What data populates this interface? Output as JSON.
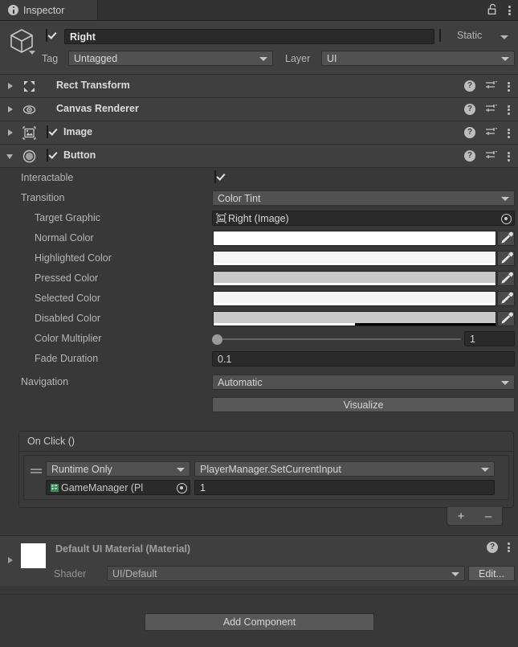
{
  "window": {
    "tab_label": "Inspector",
    "tab_icon": "info-icon",
    "lock_icon": "lock-open-icon",
    "menu_icon": "kebab-menu-icon"
  },
  "gameobject": {
    "icon": "cube-icon",
    "enabled": true,
    "name": "Right",
    "static_enabled": false,
    "static_label": "Static",
    "tag_label": "Tag",
    "tag_value": "Untagged",
    "layer_label": "Layer",
    "layer_value": "UI"
  },
  "components": [
    {
      "name": "Rect Transform",
      "icon": "rect-transform-icon",
      "expanded": false,
      "has_toggle": false,
      "enabled": false
    },
    {
      "name": "Canvas Renderer",
      "icon": "eye-icon",
      "expanded": false,
      "has_toggle": false,
      "enabled": false
    },
    {
      "name": "Image",
      "icon": "image-icon",
      "expanded": false,
      "has_toggle": true,
      "enabled": true
    },
    {
      "name": "Button",
      "icon": "button-icon",
      "expanded": true,
      "has_toggle": true,
      "enabled": true
    }
  ],
  "component_icons": {
    "help": "?",
    "preset": "preset-icon",
    "menu": "kebab-menu-icon"
  },
  "button": {
    "interactable_label": "Interactable",
    "interactable_value": true,
    "transition_label": "Transition",
    "transition_value": "Color Tint",
    "target_graphic_label": "Target Graphic",
    "target_graphic_value": "Right (Image)",
    "colors": [
      {
        "label": "Normal Color",
        "hex": "#FFFFFF",
        "alpha": 1.0
      },
      {
        "label": "Highlighted Color",
        "hex": "#F5F5F5",
        "alpha": 1.0
      },
      {
        "label": "Pressed Color",
        "hex": "#C8C8C8",
        "alpha": 1.0
      },
      {
        "label": "Selected Color",
        "hex": "#F5F5F5",
        "alpha": 1.0
      },
      {
        "label": "Disabled Color",
        "hex": "#C8C8C8",
        "alpha": 0.5
      }
    ],
    "color_multiplier_label": "Color Multiplier",
    "color_multiplier_value": "1",
    "fade_duration_label": "Fade Duration",
    "fade_duration_value": "0.1",
    "navigation_label": "Navigation",
    "navigation_value": "Automatic",
    "visualize_label": "Visualize"
  },
  "onclick": {
    "title": "On Click ()",
    "entry": {
      "mode": "Runtime Only",
      "method": "PlayerManager.SetCurrentInput",
      "object": "GameManager (Pl",
      "object_icon": "script-icon",
      "argument": "1"
    },
    "add_label": "+",
    "remove_label": "–"
  },
  "material": {
    "title": "Default UI Material (Material)",
    "shader_label": "Shader",
    "shader_value": "UI/Default",
    "edit_label": "Edit...",
    "help_icon": "help-icon",
    "menu_icon": "kebab-menu-icon"
  },
  "footer": {
    "add_component_label": "Add Component"
  }
}
